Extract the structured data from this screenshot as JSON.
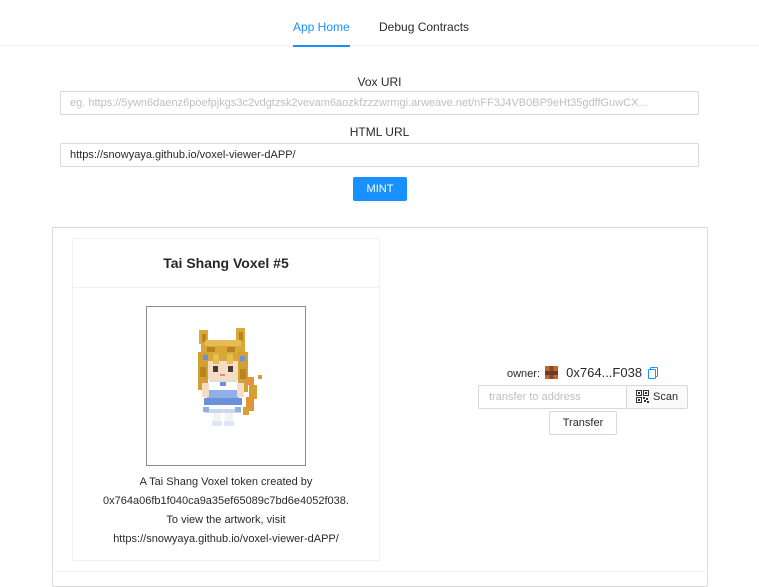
{
  "nav": {
    "tabs": [
      {
        "label": "App Home",
        "active": true
      },
      {
        "label": "Debug Contracts",
        "active": false
      }
    ]
  },
  "mint_form": {
    "vox_uri": {
      "label": "Vox URI",
      "value": "",
      "placeholder": "eg. https://5ywn6daenz6poefpjkgs3c2vdgtzsk2vevam6aozkfzzzwrmgi.arweave.net/nFF3J4VB0BP9eHt35gdffGuwCX..."
    },
    "html_url": {
      "label": "HTML URL",
      "value": "https://snowyaya.github.io/voxel-viewer-dAPP/",
      "placeholder": ""
    },
    "mint_label": "MINT"
  },
  "token_card": {
    "title": "Tai Shang Voxel #5",
    "description_lines": [
      "A Tai Shang Voxel token created by",
      "0x764a06fb1f040ca9a35ef65089c7bd6e4052f038.",
      "To view the artwork, visit",
      "https://snowyaya.github.io/voxel-viewer-dAPP/"
    ]
  },
  "owner_panel": {
    "owner_label": "owner:",
    "address_short": "0x764...F038",
    "transfer_placeholder": "transfer to address",
    "scan_label": "Scan",
    "transfer_label": "Transfer"
  },
  "colors": {
    "primary": "#1890ff",
    "border": "#d9d9d9"
  },
  "icons": [
    "blockie-avatar-icon",
    "copy-icon",
    "qrcode-icon"
  ]
}
